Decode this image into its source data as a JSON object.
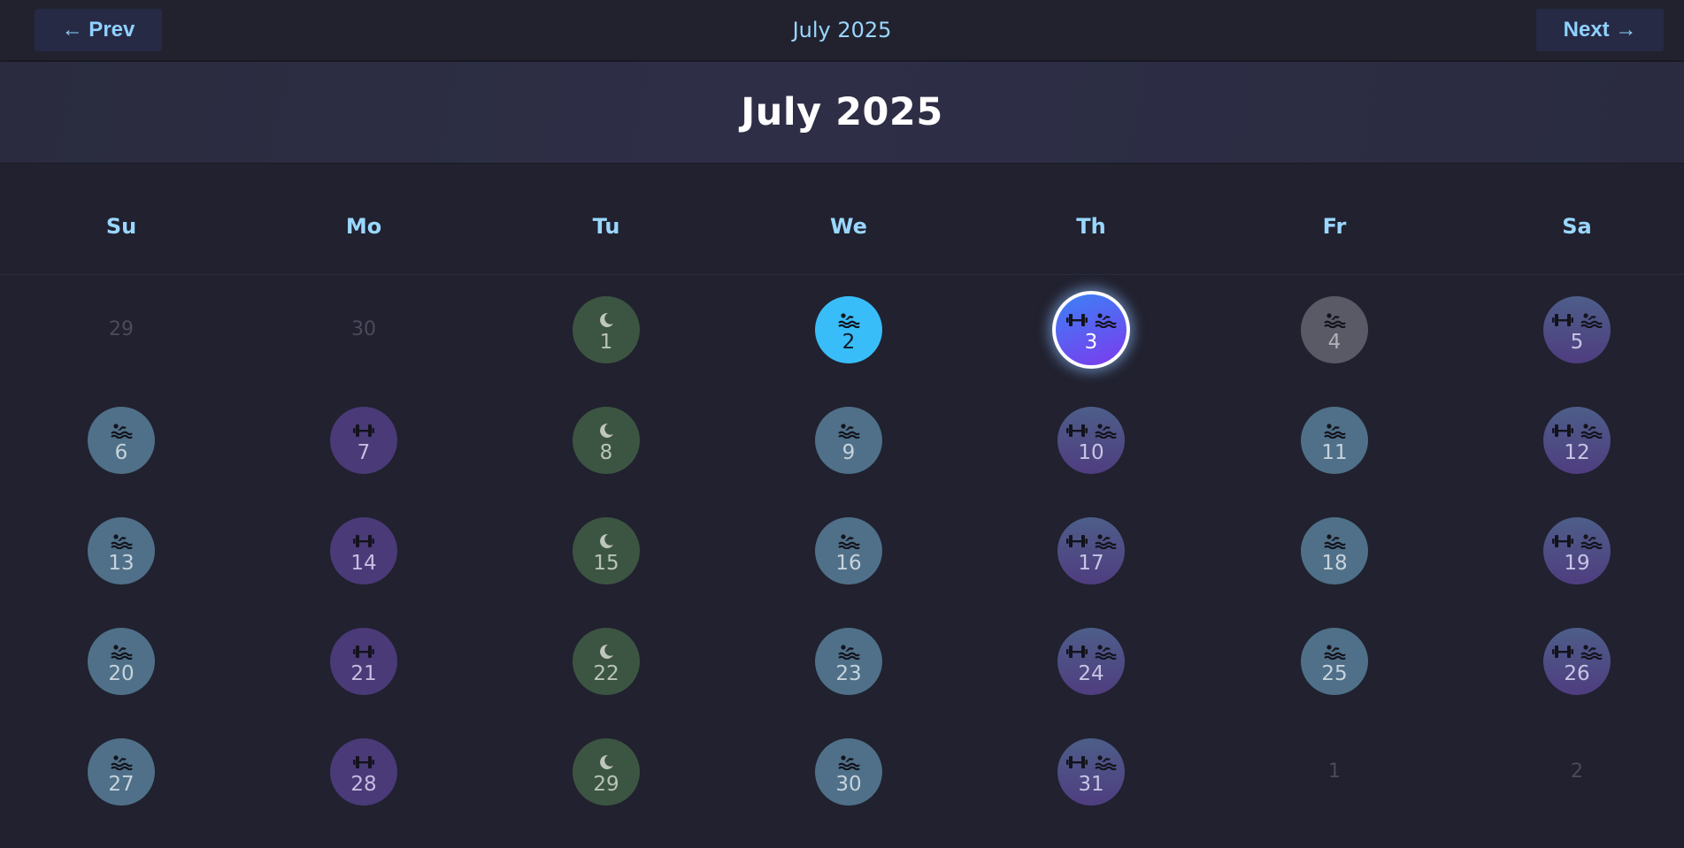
{
  "header": {
    "prev_label": "← Prev",
    "next_label": "Next →",
    "title": "July 2025"
  },
  "banner": {
    "title": "July 2025"
  },
  "weekdays": [
    "Su",
    "Mo",
    "Tu",
    "We",
    "Th",
    "Fr",
    "Sa"
  ],
  "colors": {
    "swim": "#4f7088",
    "lift": "#4a3a78",
    "rest": "#3c5542",
    "combo_start": "#4d5e89",
    "combo_end": "#4f3d80",
    "muted": "#5a5a66",
    "today": "#38bdf8",
    "selected_start": "#3b82f6",
    "selected_end": "#7c3aed"
  },
  "weeks": [
    [
      {
        "label": "29",
        "type": "other",
        "icons": []
      },
      {
        "label": "30",
        "type": "other",
        "icons": []
      },
      {
        "label": "1",
        "type": "rest",
        "icons": [
          "moon-icon"
        ]
      },
      {
        "label": "2",
        "type": "today",
        "icons": [
          "swim-icon"
        ]
      },
      {
        "label": "3",
        "type": "selected",
        "icons": [
          "dumbbell-icon",
          "swim-icon"
        ]
      },
      {
        "label": "4",
        "type": "muted",
        "icons": [
          "swim-icon"
        ]
      },
      {
        "label": "5",
        "type": "combo",
        "icons": [
          "dumbbell-icon",
          "swim-icon"
        ]
      }
    ],
    [
      {
        "label": "6",
        "type": "swim",
        "icons": [
          "swim-icon"
        ]
      },
      {
        "label": "7",
        "type": "lift",
        "icons": [
          "dumbbell-icon"
        ]
      },
      {
        "label": "8",
        "type": "rest",
        "icons": [
          "moon-icon"
        ]
      },
      {
        "label": "9",
        "type": "swim",
        "icons": [
          "swim-icon"
        ]
      },
      {
        "label": "10",
        "type": "combo",
        "icons": [
          "dumbbell-icon",
          "swim-icon"
        ]
      },
      {
        "label": "11",
        "type": "swim",
        "icons": [
          "swim-icon"
        ]
      },
      {
        "label": "12",
        "type": "combo",
        "icons": [
          "dumbbell-icon",
          "swim-icon"
        ]
      }
    ],
    [
      {
        "label": "13",
        "type": "swim",
        "icons": [
          "swim-icon"
        ]
      },
      {
        "label": "14",
        "type": "lift",
        "icons": [
          "dumbbell-icon"
        ]
      },
      {
        "label": "15",
        "type": "rest",
        "icons": [
          "moon-icon"
        ]
      },
      {
        "label": "16",
        "type": "swim",
        "icons": [
          "swim-icon"
        ]
      },
      {
        "label": "17",
        "type": "combo",
        "icons": [
          "dumbbell-icon",
          "swim-icon"
        ]
      },
      {
        "label": "18",
        "type": "swim",
        "icons": [
          "swim-icon"
        ]
      },
      {
        "label": "19",
        "type": "combo",
        "icons": [
          "dumbbell-icon",
          "swim-icon"
        ]
      }
    ],
    [
      {
        "label": "20",
        "type": "swim",
        "icons": [
          "swim-icon"
        ]
      },
      {
        "label": "21",
        "type": "lift",
        "icons": [
          "dumbbell-icon"
        ]
      },
      {
        "label": "22",
        "type": "rest",
        "icons": [
          "moon-icon"
        ]
      },
      {
        "label": "23",
        "type": "swim",
        "icons": [
          "swim-icon"
        ]
      },
      {
        "label": "24",
        "type": "combo",
        "icons": [
          "dumbbell-icon",
          "swim-icon"
        ]
      },
      {
        "label": "25",
        "type": "swim",
        "icons": [
          "swim-icon"
        ]
      },
      {
        "label": "26",
        "type": "combo",
        "icons": [
          "dumbbell-icon",
          "swim-icon"
        ]
      }
    ],
    [
      {
        "label": "27",
        "type": "swim",
        "icons": [
          "swim-icon"
        ]
      },
      {
        "label": "28",
        "type": "lift",
        "icons": [
          "dumbbell-icon"
        ]
      },
      {
        "label": "29",
        "type": "rest",
        "icons": [
          "moon-icon"
        ]
      },
      {
        "label": "30",
        "type": "swim",
        "icons": [
          "swim-icon"
        ]
      },
      {
        "label": "31",
        "type": "combo",
        "icons": [
          "dumbbell-icon",
          "swim-icon"
        ]
      },
      {
        "label": "1",
        "type": "other",
        "icons": []
      },
      {
        "label": "2",
        "type": "other",
        "icons": []
      }
    ]
  ]
}
